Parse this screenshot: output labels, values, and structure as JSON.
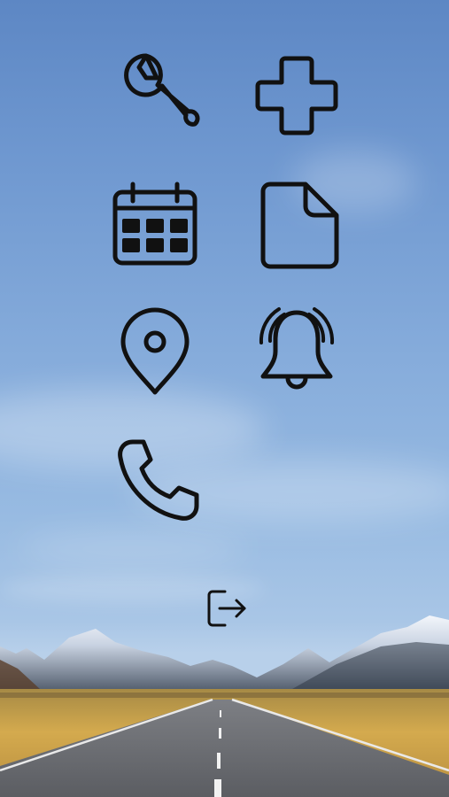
{
  "launcher": {
    "items": [
      {
        "id": "settings",
        "icon": "wrench-icon"
      },
      {
        "id": "medical",
        "icon": "medical-cross-icon"
      },
      {
        "id": "calendar",
        "icon": "calendar-icon"
      },
      {
        "id": "document",
        "icon": "document-icon"
      },
      {
        "id": "location",
        "icon": "location-pin-icon"
      },
      {
        "id": "alarm",
        "icon": "alarm-bell-icon"
      },
      {
        "id": "phone",
        "icon": "phone-icon"
      }
    ],
    "logout": {
      "icon": "logout-icon"
    }
  },
  "colors": {
    "icon_stroke": "#111111",
    "sky_top": "#5d87c4",
    "sky_bottom": "#b8d0ea",
    "field": "#c9a24a",
    "road": "#6b6d72"
  }
}
